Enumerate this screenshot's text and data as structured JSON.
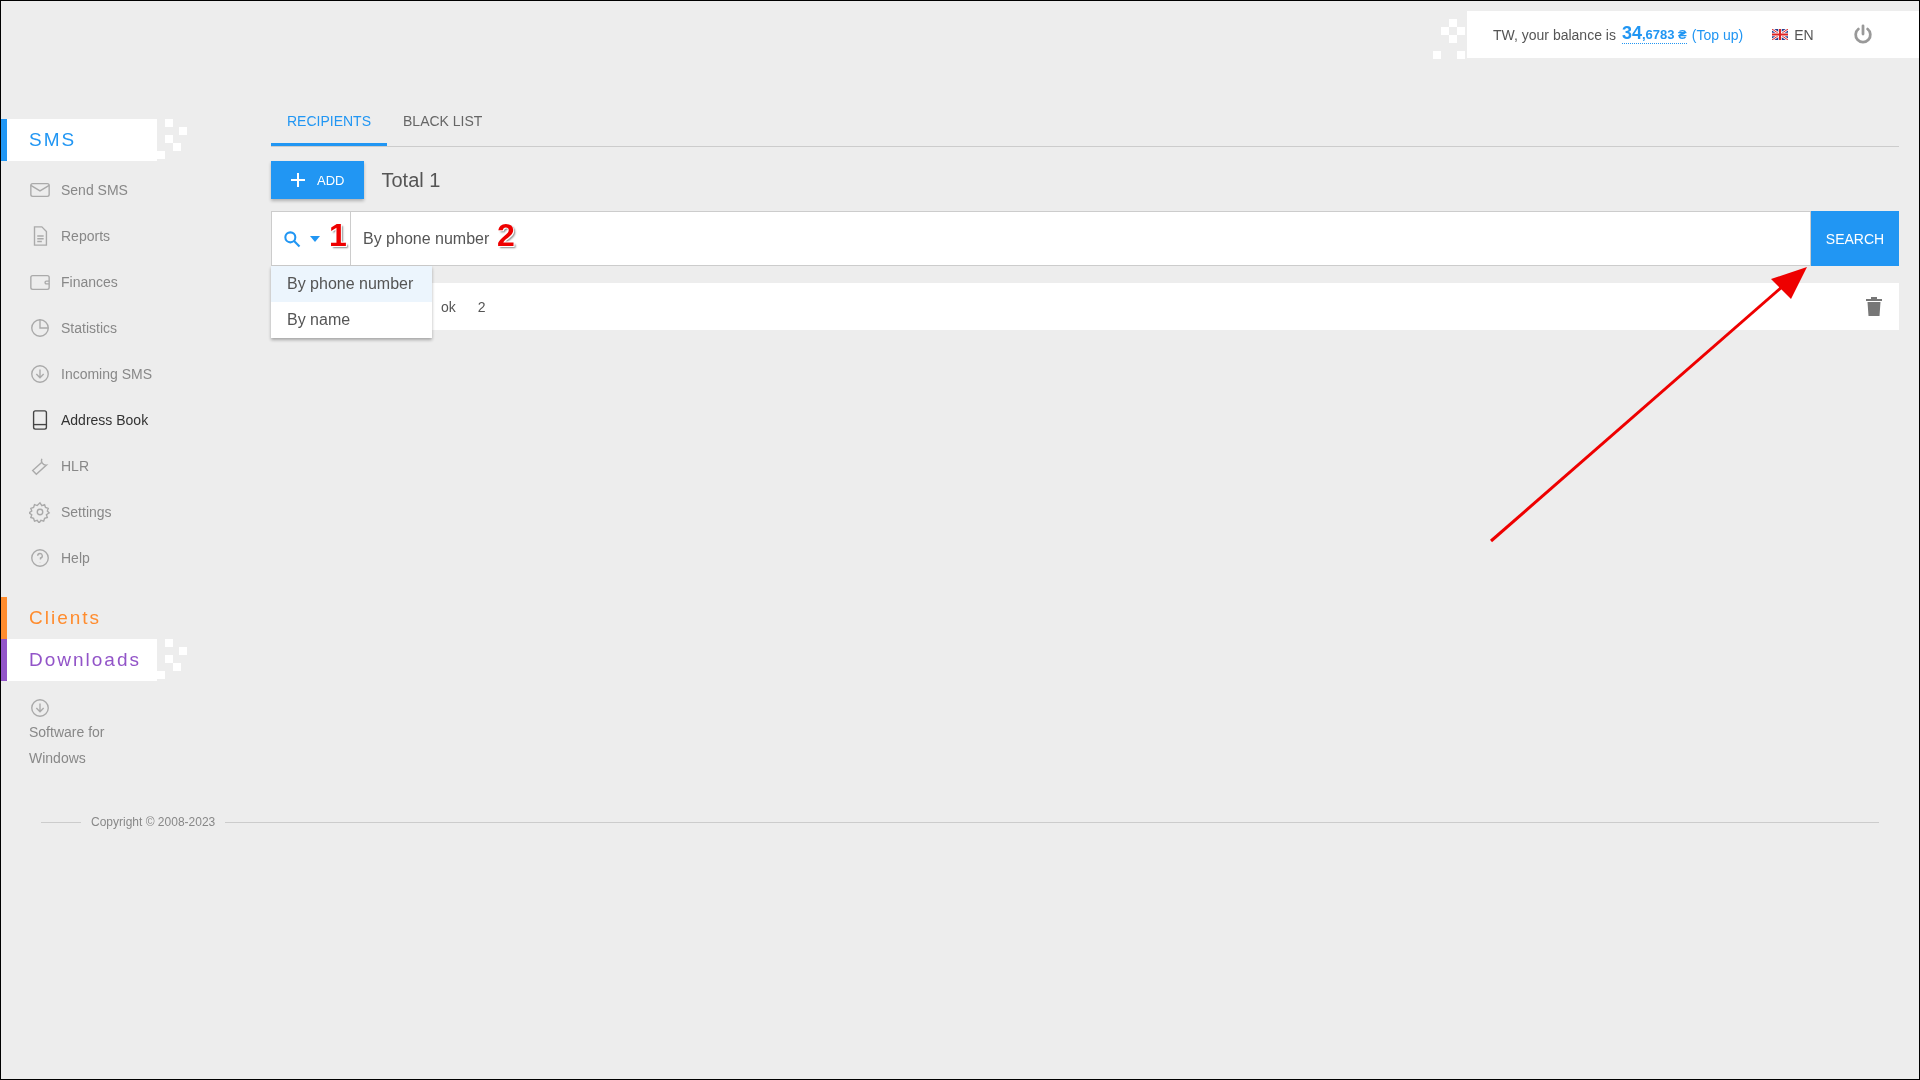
{
  "header": {
    "greeting": "TW, your balance is",
    "balance_whole": "34",
    "balance_fraction": ",6783 ₴",
    "top_up": "(Top up)",
    "language": "EN"
  },
  "sidebar": {
    "sections": [
      {
        "title": "SMS",
        "color": "#2196f3",
        "expanded": true,
        "items": [
          {
            "label": "Send SMS",
            "selected": false
          },
          {
            "label": "Reports",
            "selected": false
          },
          {
            "label": "Finances",
            "selected": false
          },
          {
            "label": "Statistics",
            "selected": false
          },
          {
            "label": "Incoming SMS",
            "selected": false
          },
          {
            "label": "Address Book",
            "selected": true
          },
          {
            "label": "HLR",
            "selected": false
          },
          {
            "label": "Settings",
            "selected": false
          },
          {
            "label": "Help",
            "selected": false
          }
        ]
      },
      {
        "title": "Clients",
        "color": "#ff8c2e",
        "expanded": false
      },
      {
        "title": "Downloads",
        "color": "#9254c8",
        "expanded": true,
        "items": [
          {
            "label": "Software for Windows",
            "selected": false
          }
        ]
      }
    ]
  },
  "tabs": [
    {
      "label": "RECIPIENTS",
      "selected": true
    },
    {
      "label": "BLACK LIST",
      "selected": false
    }
  ],
  "add_button": "ADD",
  "total": "Total 1",
  "search": {
    "value": "By phone number",
    "button": "SEARCH",
    "options": [
      {
        "label": "By phone number",
        "selected": true
      },
      {
        "label": "By name",
        "selected": false
      }
    ]
  },
  "rows": [
    {
      "name": "ok",
      "count": "2"
    }
  ],
  "annotations": [
    "1",
    "2"
  ],
  "footer": "Copyright © 2008-2023"
}
